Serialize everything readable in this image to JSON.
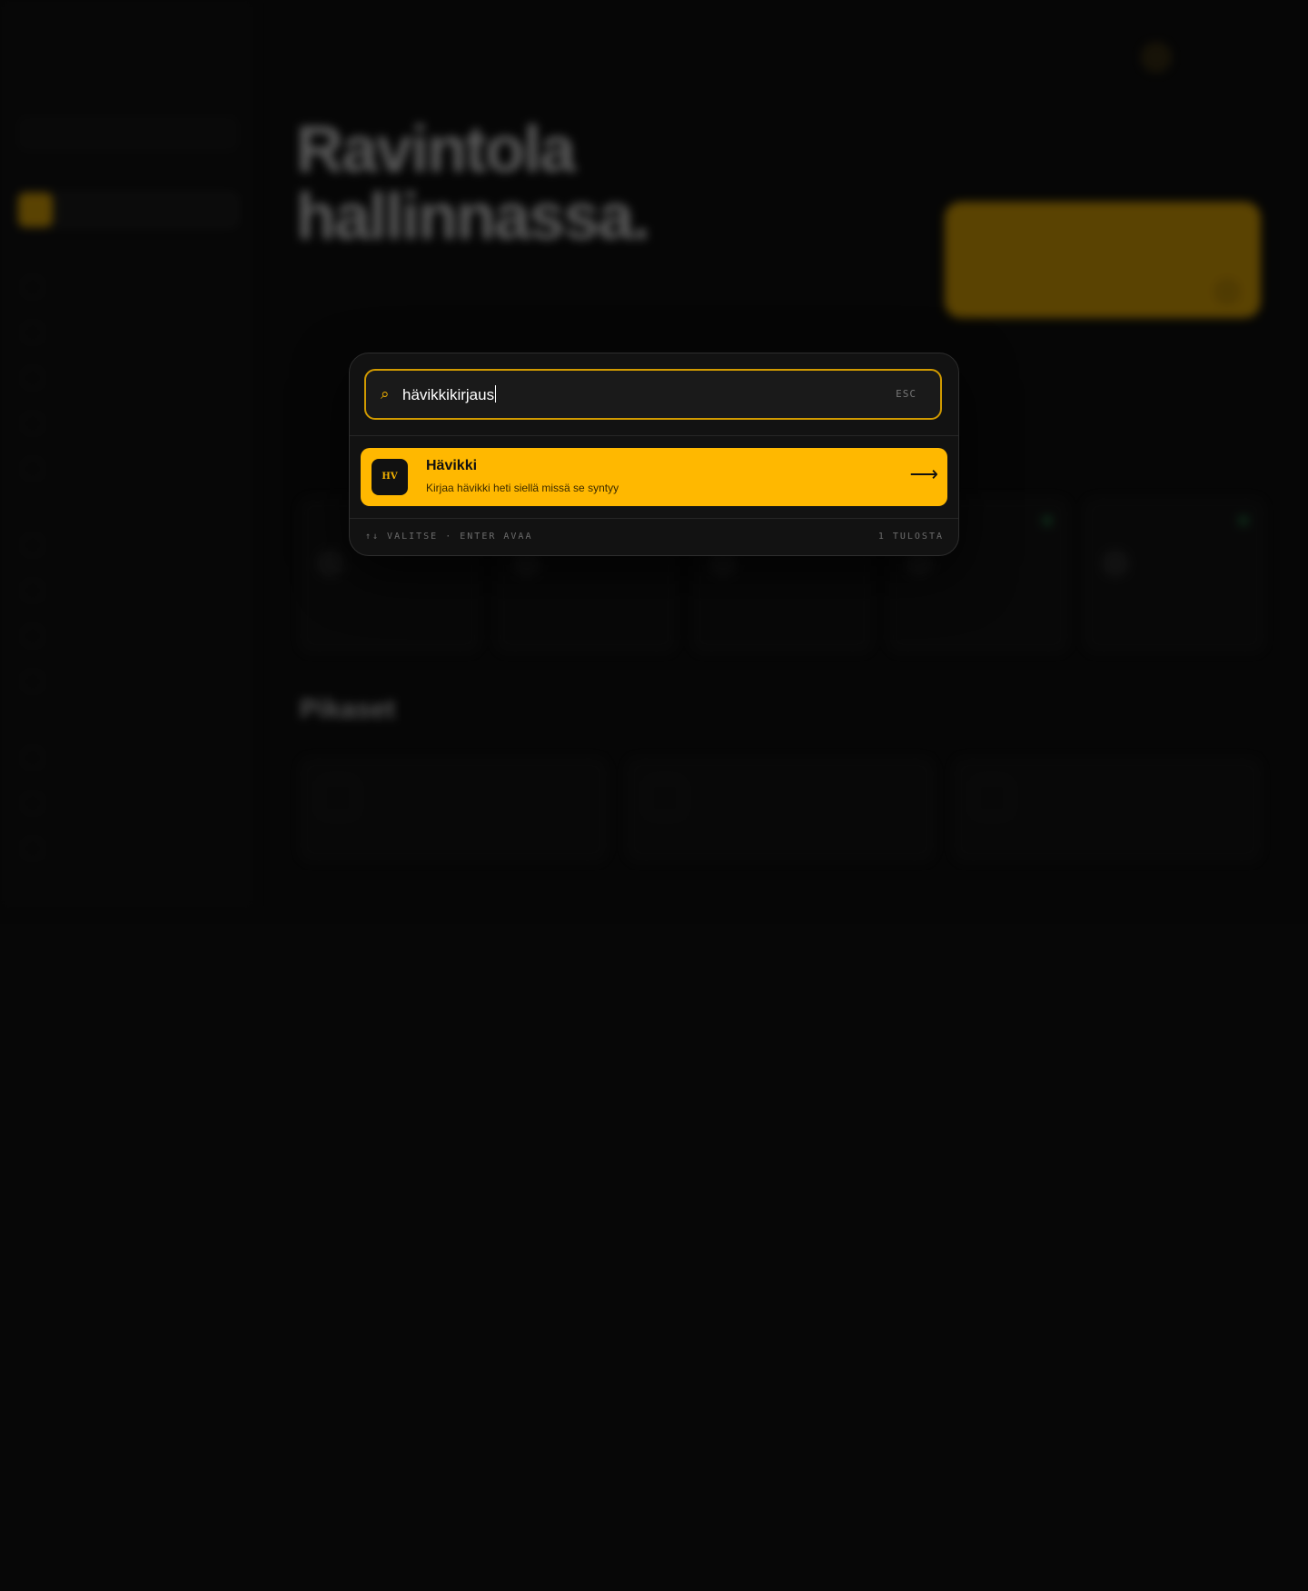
{
  "background": {
    "brand": {
      "kicker": "",
      "title": "",
      "subtitle": ""
    },
    "sidebar_search_label": "",
    "sidebar_active_label": "",
    "sidebar_items": [
      "",
      "",
      "",
      "",
      "",
      "",
      "",
      "",
      "",
      "",
      "",
      ""
    ],
    "breadcrumb": "",
    "kicker": "",
    "hero_title_line1": "Ravintola",
    "hero_title_line2": "hallinnassa.",
    "lead": "",
    "promo": {
      "kicker": "",
      "title": "",
      "subtitle": ""
    },
    "section_1_title": "",
    "section_2_title": "Pikaset",
    "cards": [
      "",
      "",
      "",
      "",
      ""
    ],
    "tools": [
      "",
      "",
      ""
    ]
  },
  "palette": {
    "query": "hävikkikirjaus",
    "esc_label": "ESC",
    "results": [
      {
        "badge": "HV",
        "title": "Hävikki",
        "description": "Kirjaa hävikki heti siellä missä se syntyy",
        "arrow": "⟶"
      }
    ],
    "hint": "↑↓ VALITSE · ENTER AVAA",
    "result_count": "1 TULOSTA"
  },
  "colors": {
    "accent": "#ffb800",
    "background": "#0a0a0a",
    "palette_bg": "#121212",
    "input_border": "#d19a00"
  },
  "icons": {
    "search": "search-icon",
    "arrow": "arrow-right-icon"
  }
}
